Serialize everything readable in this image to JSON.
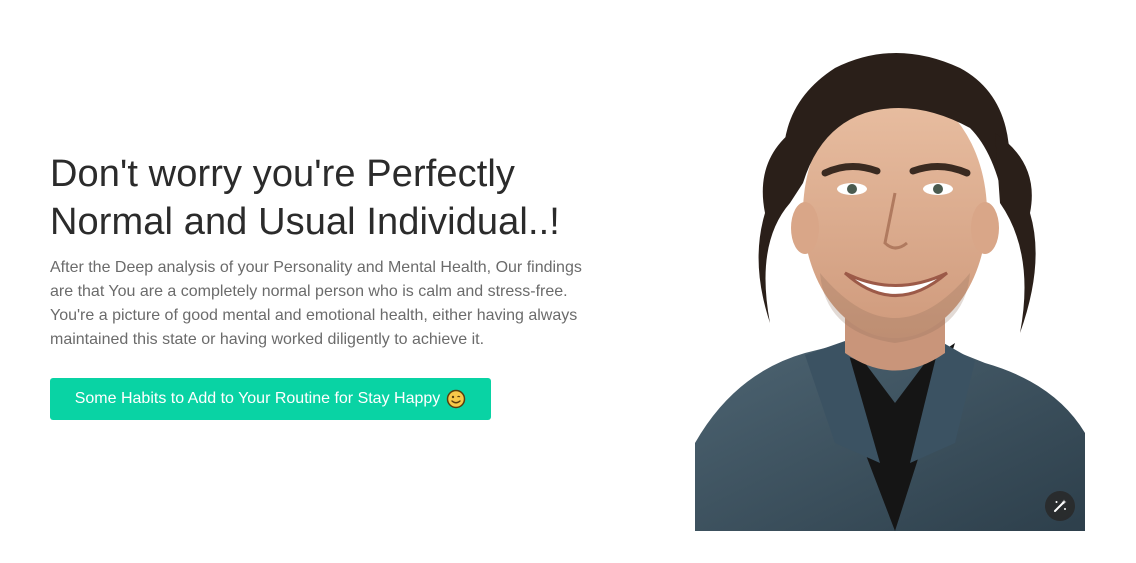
{
  "hero": {
    "headline_line1": "Don't worry you're Perfectly",
    "headline_line2": "Normal and Usual Individual..!",
    "description": "After the Deep analysis of your Personality and Mental Health, Our findings are that You are a completely normal person who is calm and stress-free. You're a picture of good mental and emotional health, either having always maintained this state or having worked diligently to achieve it.",
    "cta_label": "Some Habits to Add to Your Routine for Stay Happy"
  },
  "icons": {
    "cta_emoji": "smiling-face-icon",
    "portrait_badge": "magic-wand-icon"
  },
  "colors": {
    "accent": "#09d3a4",
    "headline": "#2b2b2b",
    "body_text": "#6b6b6b"
  }
}
